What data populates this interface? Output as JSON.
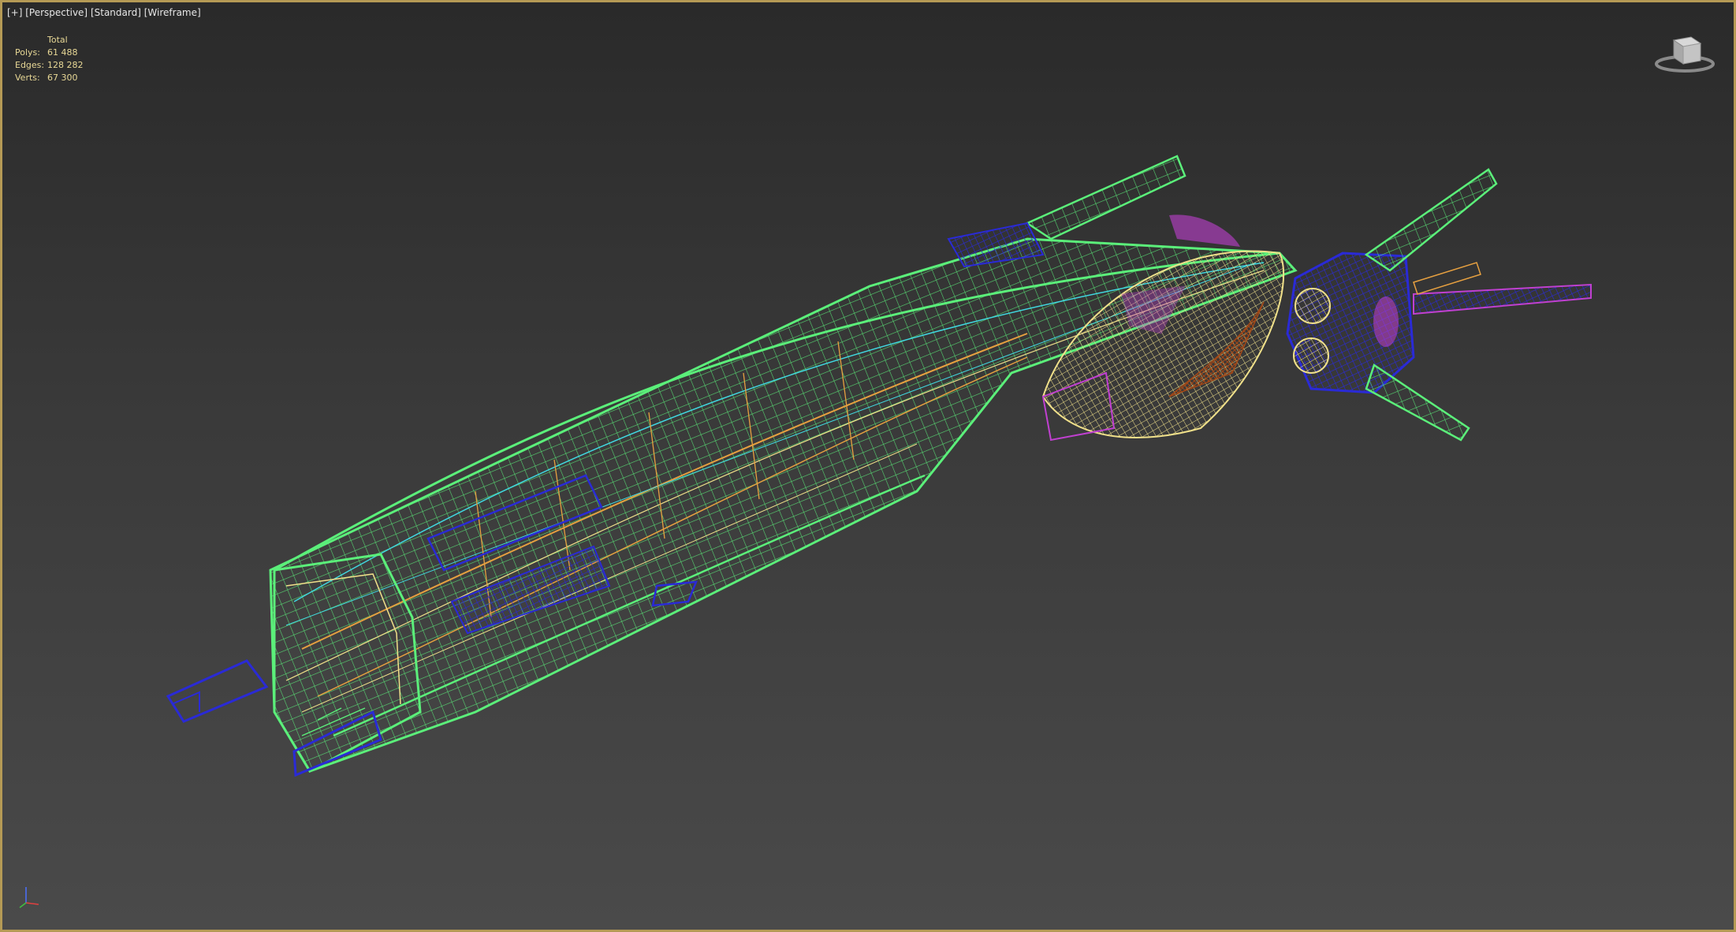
{
  "viewport": {
    "labels": [
      "[+]",
      "[Perspective]",
      "[Standard]",
      "[Wireframe]"
    ],
    "border_color": "#b59a55"
  },
  "stats": {
    "header": "Total",
    "rows": [
      {
        "label": "Polys:",
        "value": "61 488"
      },
      {
        "label": "Edges:",
        "value": "128 282"
      },
      {
        "label": "Verts:",
        "value": "67 300"
      }
    ],
    "color": "#e8d896"
  },
  "model": {
    "wire_colors": {
      "hull": "#5bef7a",
      "accent_blue": "#2a2ad6",
      "accent_yellow": "#f0e08a",
      "accent_orange": "#e6a040",
      "accent_magenta": "#c040d0",
      "accent_cyan": "#40d8e0",
      "accent_brown": "#a04818"
    }
  },
  "icons": {
    "viewcube": "viewcube-icon",
    "axis": "axis-tripod-icon"
  }
}
